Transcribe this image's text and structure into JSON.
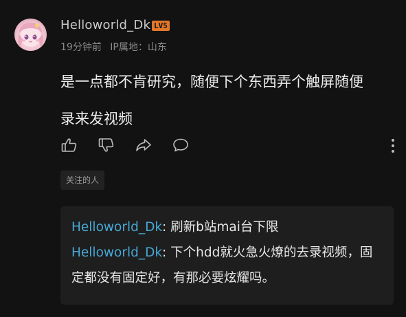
{
  "comment": {
    "username": "Helloworld_Dk",
    "level_badge": "LV5",
    "time": "19分钟前",
    "ip_location": "IP属地：山东",
    "content_line1": "是一点都不肯研究，随便下个东西弄个触屏随便",
    "content_line2": "录来发视频",
    "tag": "关注的人"
  },
  "actions": {
    "icons": [
      "thumbs-up-icon",
      "thumbs-down-icon",
      "share-icon",
      "comment-icon",
      "more-icon"
    ]
  },
  "replies": [
    {
      "author": "Helloworld_Dk",
      "separator": ": ",
      "text": "刷新b站mai台下限"
    },
    {
      "author": "Helloworld_Dk",
      "separator": ": ",
      "text": "下个hdd就火急火燎的去录视频，固定都没有固定好，有那必要炫耀吗。"
    }
  ],
  "colors": {
    "background": "#121212",
    "reply_author": "#46a8d6",
    "level_badge": "#e1782a",
    "reply_box": "#1e1e1e"
  }
}
